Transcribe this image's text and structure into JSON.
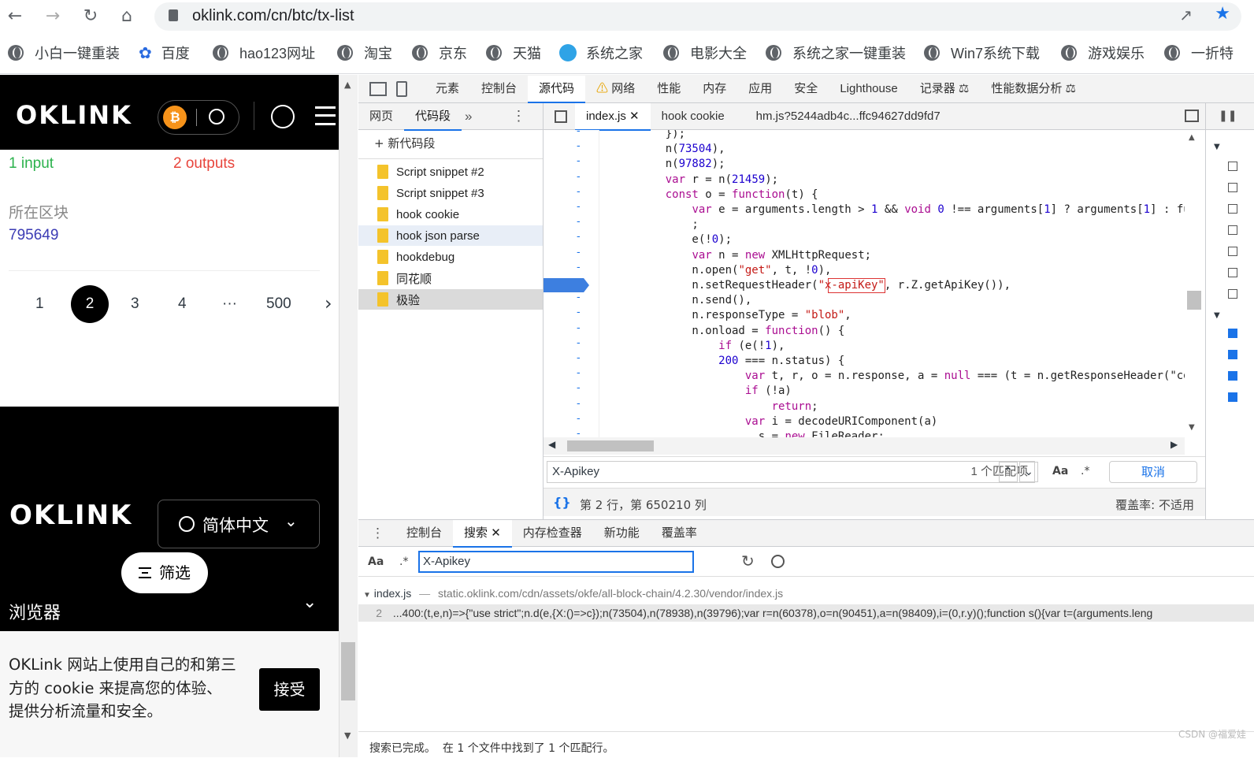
{
  "browser": {
    "url": "oklink.com/cn/btc/tx-list",
    "bookmarks": [
      "小白一键重装",
      "百度",
      "hao123网址",
      "淘宝",
      "京东",
      "天猫",
      "系统之家",
      "电影大全",
      "系统之家一键重装",
      "Win7系统下载",
      "游戏娱乐",
      "一折特"
    ]
  },
  "page": {
    "logo": "OKLINK",
    "inputs": "1 input",
    "outputs": "2 outputs",
    "block_label": "所在区块",
    "block_value": "795649",
    "pagination": [
      "1",
      "2",
      "3",
      "4",
      "···",
      "500"
    ],
    "current_page": "2",
    "footer_lang": "简体中文",
    "filter_btn": "筛选",
    "browser_section": "浏览器",
    "cookie_text": "OKLink 网站上使用自己的和第三方的 cookie 来提高您的体验、提供分析流量和安全。",
    "accept_btn": "接受"
  },
  "devtools": {
    "main_tabs": [
      "元素",
      "控制台",
      "源代码",
      "网络",
      "性能",
      "内存",
      "应用",
      "安全",
      "Lighthouse",
      "记录器",
      "性能数据分析"
    ],
    "selected_main_tab": "源代码",
    "nav_tabs": [
      "网页",
      "代码段"
    ],
    "new_snippet": "+ 新代码段",
    "snippets": [
      "Script snippet #2",
      "Script snippet #3",
      "hook cookie",
      "hook json parse",
      "hookdebug",
      "同花顺",
      "极验"
    ],
    "editor_tabs": [
      "index.js",
      "hook cookie",
      "hm.js?5244adb4c...ffc94627dd9fd7"
    ],
    "code_lines": [
      "    });",
      "    n(73504),",
      "    n(97882);",
      "    var r = n(21459);",
      "    const o = function(t) {",
      "        var e = arguments.length > 1 && void 0 !== arguments[1] ? arguments[1] : fu",
      "        ;",
      "        e(!0);",
      "        var n = new XMLHttpRequest;",
      "        n.open(\"get\", t, !0),",
      "        n.setRequestHeader(\"x-apiKey\", r.Z.getApiKey()),",
      "        n.send(),",
      "        n.responseType = \"blob\",",
      "        n.onload = function() {",
      "            if (e(!1),",
      "            200 === n.status) {",
      "                var t, r, o = n.response, a = null === (t = n.getResponseHeader(\"co",
      "                if (!a)",
      "                    return;",
      "                var i = decodeURIComponent(a)",
      "                  s = new FileReader;"
    ],
    "search_query": "X-Apikey",
    "match_count": "1 个匹配项",
    "cancel": "取消",
    "status_position": "第 2 行，第 650210 列",
    "coverage": "覆盖率: 不适用",
    "drawer_tabs": [
      "控制台",
      "搜索",
      "内存检查器",
      "新功能",
      "覆盖率"
    ],
    "drawer_search_value": "X-Apikey",
    "result_file": "index.js",
    "result_path": "static.oklink.com/cdn/assets/okfe/all-block-chain/4.2.30/vendor/index.js",
    "result_line_no": "2",
    "result_line": "...400:(t,e,n)=>{\"use strict\";n.d(e,{X:()=>c});n(73504),n(78938),n(39796);var r=n(60378),o=n(90451),a=n(98409),i=(0,r.y)();function s(){var t=(arguments.leng",
    "search_status": "搜索已完成。  在 1 个文件中找到了 1 个匹配行。",
    "watermark": "CSDN @福爱娃"
  }
}
